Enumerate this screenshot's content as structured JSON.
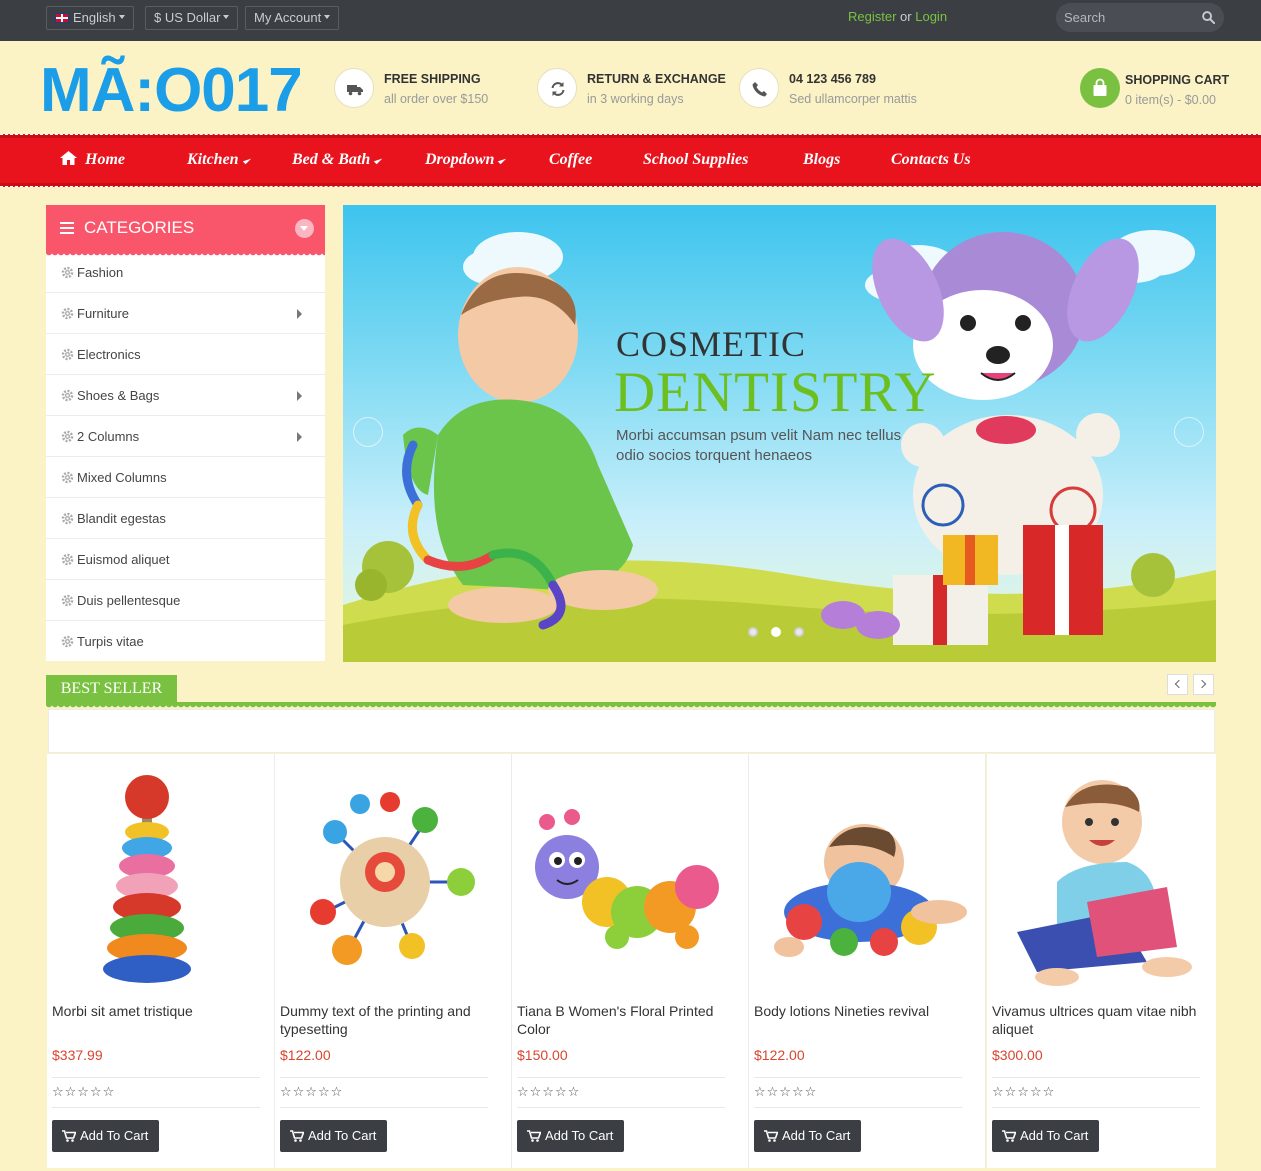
{
  "topbar": {
    "language": "English",
    "currency": "$ US Dollar",
    "account": "My Account",
    "register": "Register",
    "or": "or",
    "login": "Login",
    "search_placeholder": "Search"
  },
  "header": {
    "logo": "MÃ:O017",
    "features": [
      {
        "title": "FREE SHIPPING",
        "subtitle": "all order over $150",
        "icon": "truck-icon"
      },
      {
        "title": "RETURN & EXCHANGE",
        "subtitle": "in 3 working days",
        "icon": "refresh-icon"
      },
      {
        "title": "04 123 456 789",
        "subtitle": "Sed ullamcorper mattis",
        "icon": "phone-icon"
      }
    ],
    "cart": {
      "title": "SHOPPING CART",
      "summary": "0 item(s) - $0.00"
    }
  },
  "nav": [
    {
      "label": "Home",
      "dropdown": false
    },
    {
      "label": "Kitchen",
      "dropdown": true
    },
    {
      "label": "Bed & Bath",
      "dropdown": true
    },
    {
      "label": "Dropdown",
      "dropdown": true
    },
    {
      "label": "Coffee",
      "dropdown": false
    },
    {
      "label": "School Supplies",
      "dropdown": false
    },
    {
      "label": "Blogs",
      "dropdown": false
    },
    {
      "label": "Contacts Us",
      "dropdown": false
    }
  ],
  "categories": {
    "title": "CATEGORIES",
    "items": [
      {
        "label": "Fashion",
        "has_sub": false
      },
      {
        "label": "Furniture",
        "has_sub": true
      },
      {
        "label": "Electronics",
        "has_sub": false
      },
      {
        "label": "Shoes & Bags",
        "has_sub": true
      },
      {
        "label": "2 Columns",
        "has_sub": true
      },
      {
        "label": "Mixed Columns",
        "has_sub": false
      },
      {
        "label": "Blandit egestas",
        "has_sub": false
      },
      {
        "label": "Euismod aliquet",
        "has_sub": false
      },
      {
        "label": "Duis pellentesque",
        "has_sub": false
      },
      {
        "label": "Turpis vitae",
        "has_sub": false
      }
    ]
  },
  "slider": {
    "subtitle": "COSMETIC",
    "title": "DENTISTRY",
    "description": "Morbi accumsan psum velit Nam nec tellus odio socios torquent henaeos",
    "active_slide": 1,
    "slide_count": 3
  },
  "best_seller": {
    "title": "BEST SELLER",
    "add_label": "Add To Cart",
    "rating_stars": "☆☆☆☆☆",
    "products": [
      {
        "name": "Morbi sit amet tristique",
        "price": "$337.99"
      },
      {
        "name": "Dummy text of the printing and typesetting",
        "price": "$122.00"
      },
      {
        "name": "Tiana B Women's Floral Printed Color",
        "price": "$150.00"
      },
      {
        "name": "Body lotions Nineties revival",
        "price": "$122.00"
      },
      {
        "name": "Vivamus ultrices quam vitae nibh aliquet",
        "price": "$300.00"
      }
    ]
  },
  "colors": {
    "topbar": "#3b3f44",
    "nav_red": "#e8131c",
    "accent_green": "#7ac142",
    "category_pink": "#f9556b",
    "logo_blue": "#1b9de8",
    "price": "#d9452e",
    "background": "#fbf3c6"
  }
}
